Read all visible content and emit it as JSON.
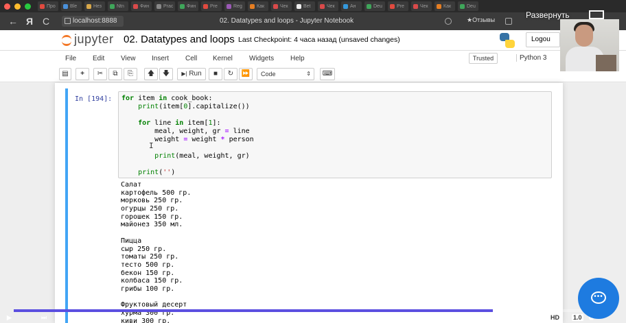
{
  "browser": {
    "tabs": [
      "Про",
      "Ble",
      "Нез",
      "Ntn",
      "Фин",
      "Prac",
      "Фин",
      "Pre",
      "Reg",
      "Как",
      "Чек",
      "Bet",
      "Чек",
      "Ан",
      "Deu",
      "Pre",
      "Чек",
      "Как",
      "Deu"
    ],
    "url": "localhost:8888",
    "page_title": "02. Datatypes and loops - Jupyter Notebook",
    "reviews_label": "★Отзывы",
    "back_icon": "←",
    "yandex_letter": "Я",
    "reload_icon": "C"
  },
  "jupyter": {
    "logo_text": "jupyter",
    "notebook_name": "02. Datatypes and loops",
    "checkpoint": "Last Checkpoint: 4 часа назад  (unsaved changes)",
    "logout_label": "Logou",
    "menu": [
      "File",
      "Edit",
      "View",
      "Insert",
      "Cell",
      "Kernel",
      "Widgets",
      "Help"
    ],
    "trusted_label": "Trusted",
    "kernel_name": "Python 3",
    "run_label": "Run",
    "cell_type": "Code"
  },
  "cell": {
    "prompt": "In [194]:",
    "output_lines": [
      "Салат",
      "картофель 500 гр.",
      "морковь 250 гр.",
      "огурцы 250 гр.",
      "горошек 150 гр.",
      "майонез 350 мл.",
      "",
      "Пицца",
      "сыр 250 гр.",
      "томаты 250 гр.",
      "тесто 500 гр.",
      "бекон 150 гр.",
      "колбаса 150 гр.",
      "грибы 100 гр.",
      "",
      "Фруктовый десерт",
      "хурма 300 гр.",
      "киви 300 гр."
    ]
  },
  "video": {
    "expand_label": "Развернуть",
    "progress_fraction": 0.8,
    "hd_label": "HD",
    "speed_label": "1.0"
  },
  "colors": {
    "cell_border": "#42a5f5",
    "progress": "#5b4fe0",
    "chat_button": "#1e7be0",
    "jupyter_orange": "#f37726"
  }
}
